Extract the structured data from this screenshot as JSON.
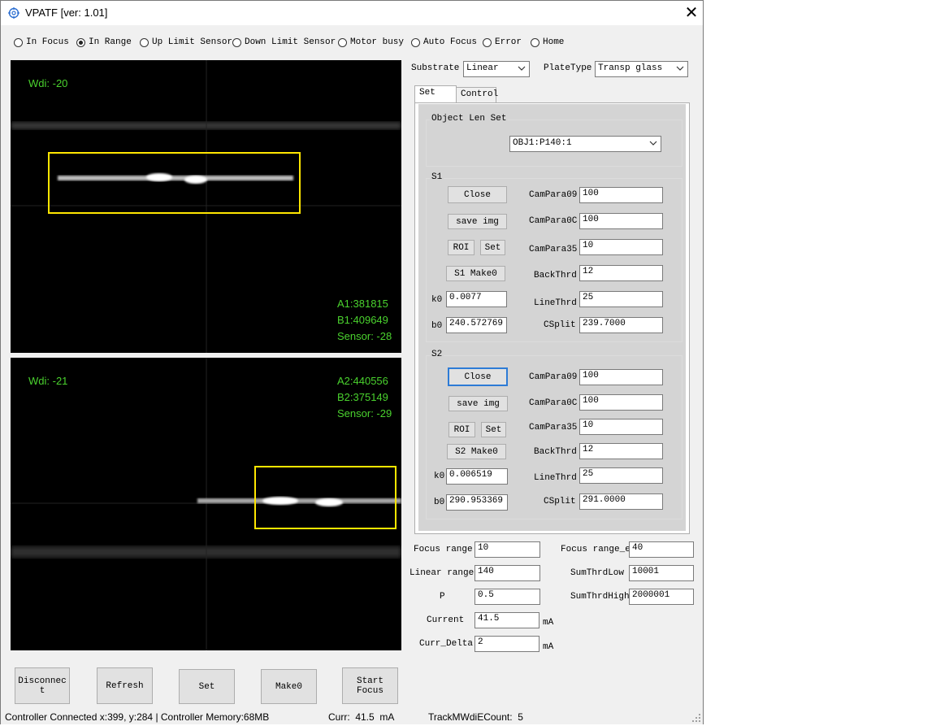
{
  "window": {
    "title": "VPATF [ver: 1.01]",
    "close_glyph": "✕"
  },
  "status_radios": [
    {
      "label": "In Focus",
      "checked": false
    },
    {
      "label": "In Range",
      "checked": true
    },
    {
      "label": "Up Limit Sensor",
      "checked": false
    },
    {
      "label": "Down Limit Sensor",
      "checked": false
    },
    {
      "label": "Motor busy",
      "checked": false
    },
    {
      "label": "Auto Focus",
      "checked": false
    },
    {
      "label": "Error",
      "checked": false
    },
    {
      "label": "Home",
      "checked": false
    }
  ],
  "camera1": {
    "wdi": "Wdi: -20",
    "a": "A1:381815",
    "b": "B1:409649",
    "sensor": "Sensor: -28"
  },
  "camera2": {
    "wdi": "Wdi: -21",
    "a": "A2:440556",
    "b": "B2:375149",
    "sensor": "Sensor: -29"
  },
  "substrate": {
    "label": "Substrate",
    "value": "Linear"
  },
  "platetype": {
    "label": "PlateType",
    "value": "Transp glass"
  },
  "tabs": [
    {
      "label": "Set",
      "active": true
    },
    {
      "label": "Control",
      "active": false
    }
  ],
  "objlen": {
    "group": "Object Len Set",
    "value": "OBJ1:P140:1"
  },
  "s1": {
    "group": "S1",
    "close": "Close",
    "save": "save img",
    "roi": "ROI",
    "set": "Set",
    "make0": "S1 Make0",
    "k0_label": "k0",
    "k0": "0.0077",
    "b0_label": "b0",
    "b0": "240.572769",
    "params": [
      {
        "label": "CamPara09",
        "value": "100"
      },
      {
        "label": "CamPara0C",
        "value": "100"
      },
      {
        "label": "CamPara35",
        "value": "10"
      },
      {
        "label": "BackThrd",
        "value": "12"
      },
      {
        "label": "LineThrd",
        "value": "25"
      },
      {
        "label": "CSplit",
        "value": "239.7000"
      }
    ]
  },
  "s2": {
    "group": "S2",
    "close": "Close",
    "save": "save img",
    "roi": "ROI",
    "set": "Set",
    "make0": "S2 Make0",
    "k0_label": "k0",
    "k0": "0.006519",
    "b0_label": "b0",
    "b0": "290.953369",
    "params": [
      {
        "label": "CamPara09",
        "value": "100"
      },
      {
        "label": "CamPara0C",
        "value": "100"
      },
      {
        "label": "CamPara35",
        "value": "10"
      },
      {
        "label": "BackThrd",
        "value": "12"
      },
      {
        "label": "LineThrd",
        "value": "25"
      },
      {
        "label": "CSplit",
        "value": "291.0000"
      }
    ]
  },
  "settings": {
    "focus_range": {
      "label": "Focus range",
      "value": "10"
    },
    "focus_range_e": {
      "label": "Focus range_e",
      "value": "40"
    },
    "linear_range": {
      "label": "Linear range",
      "value": "140"
    },
    "sumthrdlow": {
      "label": "SumThrdLow",
      "value": "10001"
    },
    "p": {
      "label": "P",
      "value": "0.5"
    },
    "sumthrdhigh": {
      "label": "SumThrdHigh",
      "value": "2000001"
    },
    "current": {
      "label": "Current",
      "value": "41.5",
      "unit": "mA"
    },
    "curr_delta": {
      "label": "Curr_Delta",
      "value": "2",
      "unit": "mA"
    }
  },
  "bottom_buttons": {
    "disconnect": "Disconnec\nt",
    "refresh": "Refresh",
    "set": "Set",
    "make0": "Make0",
    "start_focus": "Start\nFocus"
  },
  "statusbar": {
    "connection": "Controller Connected  x:399, y:284  | Controller Memory:68MB",
    "curr": "Curr:  41.5  mA",
    "track": "TrackMWdiECount:  5"
  },
  "colors": {
    "overlay_text": "#4ad22e",
    "roi_box": "#ffe600",
    "focus_border": "#2d7bd6"
  }
}
